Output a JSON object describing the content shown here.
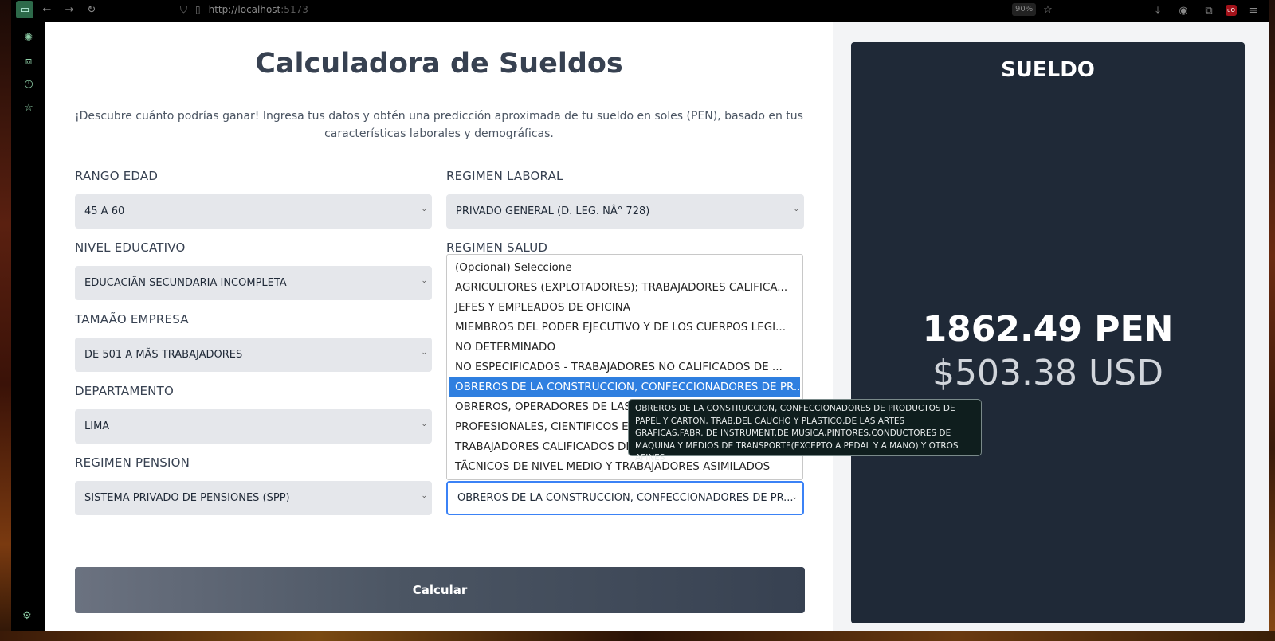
{
  "browser": {
    "url_host": "http://localhost",
    "url_port": ":5173",
    "zoom": "90%"
  },
  "page": {
    "title": "Calculadora de Sueldos",
    "subtitle": "¡Descubre cuánto podrías ganar! Ingresa tus datos y obtén una predicción aproximada de tu sueldo en soles (PEN), basado en tus características laborales y demográficas."
  },
  "fields": {
    "rango_edad": {
      "label": "RANGO EDAD",
      "value": "45 A 60"
    },
    "regimen_laboral": {
      "label": "REGIMEN LABORAL",
      "value": "PRIVADO GENERAL (D. LEG. NÂ° 728)"
    },
    "nivel_educativo": {
      "label": "NIVEL EDUCATIVO",
      "value": "EDUCACIÃN SECUNDARIA INCOMPLETA"
    },
    "regimen_salud": {
      "label": "REGIMEN SALUD"
    },
    "tamano_empresa": {
      "label": "TAMAÃO EMPRESA",
      "value": "DE 501 A MÃS TRABAJADORES"
    },
    "departamento": {
      "label": "DEPARTAMENTO",
      "value": "LIMA"
    },
    "regimen_pension": {
      "label": "REGIMEN PENSION",
      "value": "SISTEMA PRIVADO DE PENSIONES (SPP)"
    },
    "ocupacion": {
      "value": "OBREROS DE LA CONSTRUCCION, CONFECCIONADORES DE PR..."
    }
  },
  "dropdown": {
    "options": [
      "(Opcional) Seleccione",
      "AGRICULTORES (EXPLOTADORES); TRABAJADORES CALIFICA...",
      "JEFES Y EMPLEADOS DE OFICINA",
      "MIEMBROS DEL PODER EJECUTIVO Y DE LOS CUERPOS LEGI...",
      "NO DETERMINADO",
      "NO ESPECIFICADOS - TRABAJADORES NO CALIFICADOS DE ...",
      "OBREROS DE LA CONSTRUCCION, CONFECCIONADORES DE PR...",
      "OBREROS, OPERADORES DE LAS A",
      "PROFESIONALES, CIENTIFICOS E IN",
      "TRABAJADORES CALIFICADOS DE L",
      "TÃCNICOS DE NIVEL MEDIO Y TRABAJADORES ASIMILADOS"
    ],
    "selected_index": 6,
    "tooltip": "OBREROS DE LA CONSTRUCCION, CONFECCIONADORES DE PRODUCTOS DE PAPEL Y CARTON, TRAB.DEL CAUCHO Y PLASTICO,DE LAS ARTES GRAFICAS,FABR. DE INSTRUMENT.DE MUSICA,PINTORES,CONDUCTORES DE MAQUINA Y MEDIOS DE TRANSPORTE(EXCEPTO A PEDAL Y A MANO) Y OTROS AFINES"
  },
  "actions": {
    "calculate_label": "Calcular"
  },
  "result": {
    "title": "SUELDO",
    "pen": "1862.49 PEN",
    "usd": "$503.38 USD"
  },
  "colors": {
    "panel_bg": "#1f2937",
    "accent_blue": "#2f7fe0",
    "field_bg": "#e5e7eb"
  }
}
